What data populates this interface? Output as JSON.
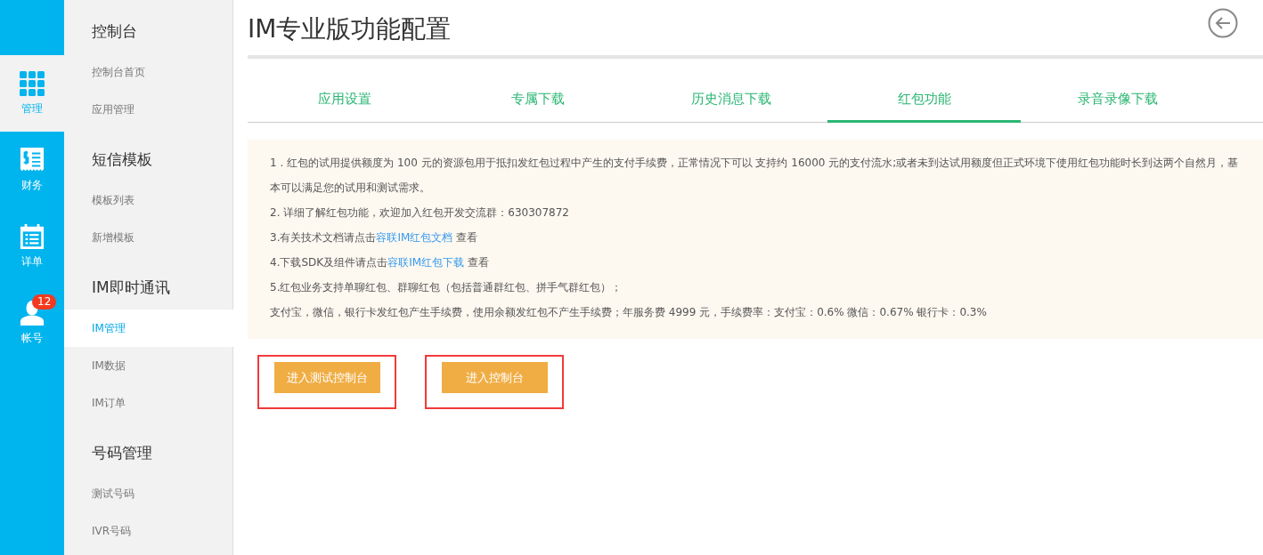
{
  "rail": [
    {
      "kind": "apps",
      "label": "管理",
      "selected": true
    },
    {
      "kind": "finance",
      "label": "财务",
      "selected": false
    },
    {
      "kind": "calendar",
      "label": "详单",
      "selected": false
    },
    {
      "kind": "account",
      "label": "帐号",
      "selected": false,
      "badge": "12"
    }
  ],
  "sidebar": [
    {
      "heading": "控制台",
      "items": [
        {
          "label": "控制台首页",
          "selected": false
        },
        {
          "label": "应用管理",
          "selected": false
        }
      ]
    },
    {
      "heading": "短信模板",
      "items": [
        {
          "label": "模板列表",
          "selected": false
        },
        {
          "label": "新增模板",
          "selected": false
        }
      ]
    },
    {
      "heading": "IM即时通讯",
      "items": [
        {
          "label": "IM管理",
          "selected": true
        },
        {
          "label": "IM数据",
          "selected": false
        },
        {
          "label": "IM订单",
          "selected": false
        }
      ]
    },
    {
      "heading": "号码管理",
      "items": [
        {
          "label": "测试号码",
          "selected": false
        },
        {
          "label": "IVR号码",
          "selected": false
        }
      ]
    }
  ],
  "page": {
    "title": "IM专业版功能配置"
  },
  "tabs": [
    {
      "label": "应用设置",
      "selected": false
    },
    {
      "label": "专属下载",
      "selected": false
    },
    {
      "label": "历史消息下载",
      "selected": false
    },
    {
      "label": "红包功能",
      "selected": true
    },
    {
      "label": "录音录像下载",
      "selected": false
    }
  ],
  "notice": [
    {
      "text": "1 . 红包的试用提供额度为 100 元的资源包用于抵扣发红包过程中产生的支付手续费，正常情况下可以 支持约 16000 元的支付流水;或者未到达试用额度但正式环境下使用红包功能时长到达两个自然月，基本可以满足您的试用和测试需求。"
    },
    {
      "text": "2. 详细了解红包功能，欢迎加入红包开发交流群：630307872"
    },
    {
      "text": "3.有关技术文档请点击",
      "link": "容联IM红包文档",
      "after": " 查看"
    },
    {
      "text": "4.下载SDK及组件请点击",
      "link": "容联IM红包下载",
      "after": " 查看"
    },
    {
      "text": "5.红包业务支持单聊红包、群聊红包（包括普通群红包、拼手气群红包）；"
    },
    {
      "text": "支付宝，微信，银行卡发红包产生手续费，使用余额发红包不产生手续费；年服务费 4999 元，手续费率：支付宝：0.6% 微信：0.67% 银行卡：0.3%"
    }
  ],
  "buttons": [
    {
      "label": "进入测试控制台",
      "highlighted": true
    },
    {
      "label": "进入控制台",
      "highlighted": true
    }
  ]
}
